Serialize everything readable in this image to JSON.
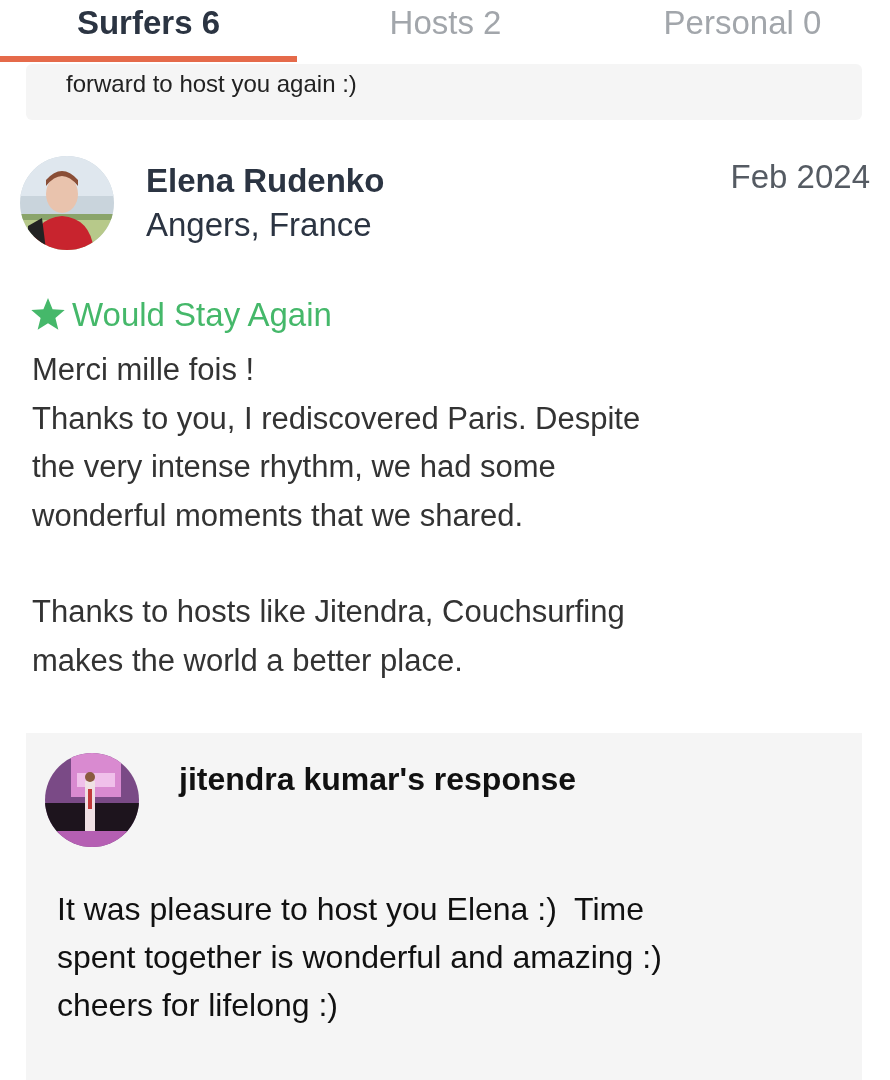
{
  "tabs": [
    {
      "label": "Surfers 6",
      "selected": true
    },
    {
      "label": "Hosts 2",
      "selected": false
    },
    {
      "label": "Personal 0",
      "selected": false
    }
  ],
  "previous_card": {
    "text": "forward to host you again :)"
  },
  "review": {
    "avatar": {
      "kind": "picture"
    },
    "name": "Elena Rudenko",
    "location": "Angers, France",
    "date": "Feb 2024",
    "recommendation": "Would Stay Again",
    "paragraphs": [
      "Merci mille fois !\nThanks to you, I rediscovered Paris. Despite\nthe very intense rhythm, we had some\nwonderful moments that we shared.",
      "Thanks to hosts like Jitendra, Couchsurfing\nmakes the world a better place."
    ]
  },
  "response": {
    "avatar": {
      "kind": "picture"
    },
    "title": "jitendra kumar's response",
    "text": "It was pleasure to host you Elena :)  Time\nspent together is wonderful and amazing :)\ncheers for lifelong :)"
  }
}
